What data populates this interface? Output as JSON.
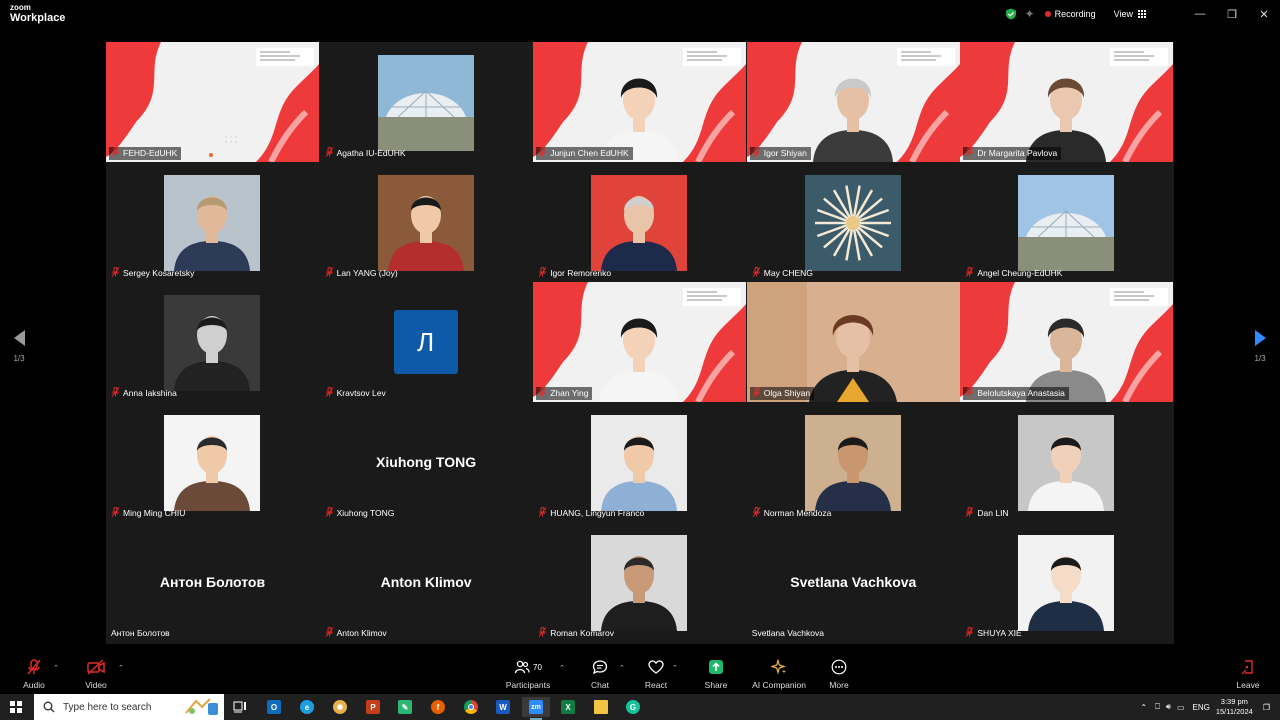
{
  "app": {
    "logo_small": "zoom",
    "logo_big": "Workplace"
  },
  "titlebar": {
    "recording": "Recording",
    "view": "View"
  },
  "colors": {
    "active_speaker": "#23d97c",
    "recording": "#e02a2a",
    "muted": "#e02a2a",
    "accent_blue": "#2d8cff"
  },
  "navigation": {
    "prev_page": "1/3",
    "next_page": "1/3"
  },
  "participants": [
    {
      "name": "FEHD-EdUHK",
      "tile": "slide"
    },
    {
      "name": "Agatha IU-EdUHK",
      "tile": "photo"
    },
    {
      "name": "Junjun Chen EdUHK",
      "tile": "video-slide"
    },
    {
      "name": "Igor Shiyan",
      "tile": "video-slide"
    },
    {
      "name": "Dr Margarita Pavlova",
      "tile": "video-slide"
    },
    {
      "name": "Sergey Kosaretsky",
      "tile": "photo"
    },
    {
      "name": "Lan YANG (Joy)",
      "tile": "photo"
    },
    {
      "name": "Igor Remorenko",
      "tile": "photo"
    },
    {
      "name": "May CHENG",
      "tile": "photo"
    },
    {
      "name": "Angel Cheung-EdUHK",
      "tile": "photo"
    },
    {
      "name": "Anna Iakshina",
      "tile": "photo"
    },
    {
      "name": "Kravtsov Lev",
      "tile": "avatar",
      "avatar_letter": "Л"
    },
    {
      "name": "Zhan Ying",
      "tile": "video-slide",
      "active": true
    },
    {
      "name": "Olga Shiyan",
      "tile": "video"
    },
    {
      "name": "Belolutskaya Anastasia",
      "tile": "video-slide"
    },
    {
      "name": "Ming Ming CHIU",
      "tile": "photo"
    },
    {
      "name": "Xiuhong TONG",
      "tile": "name",
      "display": "Xiuhong TONG"
    },
    {
      "name": "HUANG, Lingyun Franco",
      "tile": "photo"
    },
    {
      "name": "Norman Mendoza",
      "tile": "photo"
    },
    {
      "name": "Dan LIN",
      "tile": "photo"
    },
    {
      "name": "Антон Болотов",
      "tile": "name",
      "display": "Антон Болотов",
      "unmuted": true
    },
    {
      "name": "Anton Klimov",
      "tile": "name",
      "display": "Anton Klimov"
    },
    {
      "name": "Roman Komarov",
      "tile": "photo"
    },
    {
      "name": "Svetlana Vachkova",
      "tile": "name",
      "display": "Svetlana Vachkova",
      "unmuted": true
    },
    {
      "name": "SHUYA XIE",
      "tile": "photo"
    }
  ],
  "toolbar": {
    "audio": "Audio",
    "video": "Video",
    "participants": "Participants",
    "participants_count": "70",
    "chat": "Chat",
    "react": "React",
    "share": "Share",
    "ai_companion": "AI Companion",
    "more": "More",
    "leave": "Leave"
  },
  "taskbar": {
    "search_placeholder": "Type here to search",
    "language": "ENG",
    "time": "3:39 pm",
    "date": "15/11/2024"
  }
}
